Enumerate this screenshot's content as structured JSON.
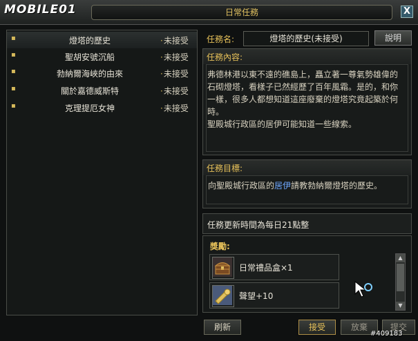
{
  "window": {
    "logo": "MOBILE01",
    "title": "日常任務",
    "close_glyph": "X"
  },
  "quest_list": [
    {
      "name": "燈塔的歷史",
      "status": "未接受",
      "selected": true
    },
    {
      "name": "聖胡安號沉船",
      "status": "未接受",
      "selected": false
    },
    {
      "name": "勃納爾海峽的由來",
      "status": "未接受",
      "selected": false
    },
    {
      "name": "關於嘉德威斯特",
      "status": "未接受",
      "selected": false
    },
    {
      "name": "克理提厄女神",
      "status": "未接受",
      "selected": false
    }
  ],
  "detail": {
    "name_label": "任務名:",
    "name_value": "燈塔的歷史(未接受)",
    "explain_button": "說明",
    "content_label": "任務內容:",
    "content_lines": [
      "弗德林港以東不遠的礁島上，矗立著一尊氣勢雄偉的",
      "石砌燈塔，看樣子已然經歷了百年風霜。是的，和你",
      "一樣，很多人都想知道這座廢棄的燈塔究竟起築於何",
      "時。",
      "聖殿城行政區的居伊可能知道一些線索。"
    ],
    "goal_label": "任務目標:",
    "goal_prefix": "向聖殿城行政區的",
    "goal_npc": "居伊",
    "goal_suffix": "請教勃納爾燈塔的歷史。",
    "refresh_info": "任務更新時間為每日21點整"
  },
  "rewards": {
    "label": "獎勵:",
    "items": [
      {
        "name": "日常禮品盒×1",
        "icon": "treasure-chest-icon"
      },
      {
        "name": "聲望+10",
        "icon": "trumpet-icon"
      }
    ]
  },
  "buttons": {
    "refresh": "刷新",
    "accept": "接受",
    "abandon": "放棄",
    "submit": "提交"
  },
  "watermark": "#409183",
  "colors": {
    "accent_gold": "#e8c25a",
    "npc_link": "#6fa8ff"
  }
}
